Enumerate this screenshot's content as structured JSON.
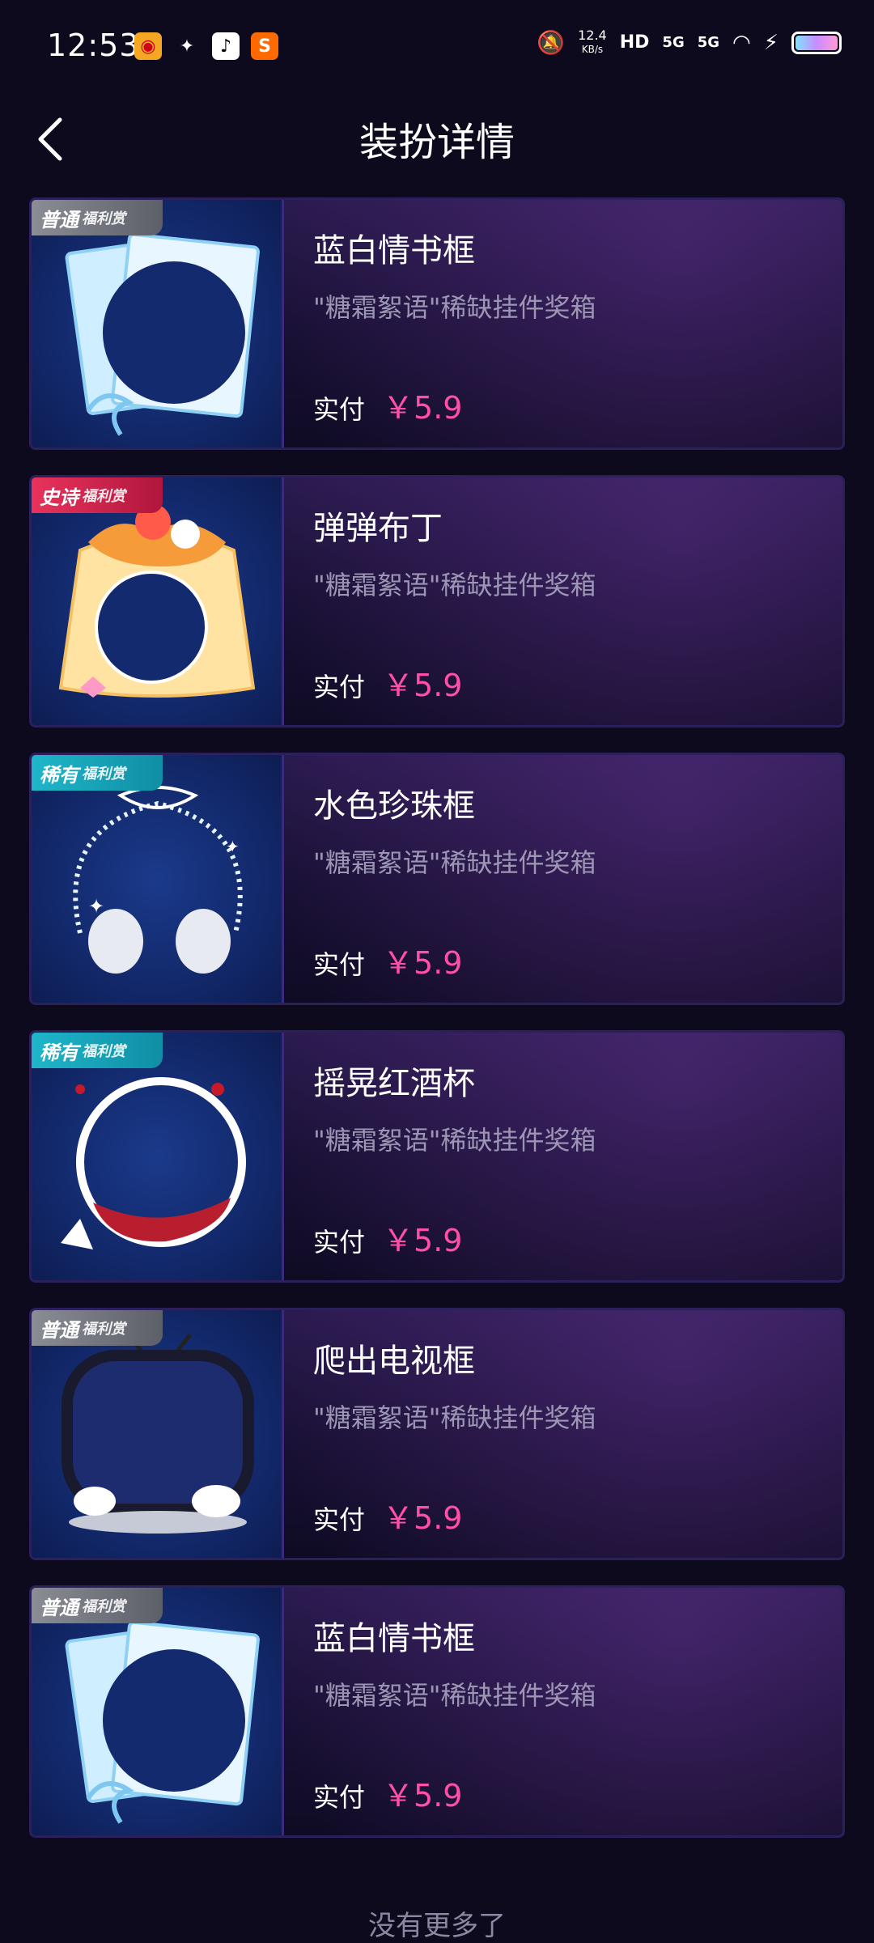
{
  "status_bar": {
    "time": "12:53",
    "net_speed_value": "12.4",
    "net_speed_unit": "KB/s",
    "signal_labels": [
      "HD",
      "5G",
      "5G"
    ]
  },
  "header": {
    "title": "装扮详情"
  },
  "items": [
    {
      "badge": "普通",
      "badge_sub": "福利赏",
      "badge_type": "common",
      "name": "蓝白情书框",
      "source": "\"糖霜絮语\"稀缺挂件奖箱",
      "price_label": "实付",
      "price": "￥5.9"
    },
    {
      "badge": "史诗",
      "badge_sub": "福利赏",
      "badge_type": "epic",
      "name": "弹弹布丁",
      "source": "\"糖霜絮语\"稀缺挂件奖箱",
      "price_label": "实付",
      "price": "￥5.9"
    },
    {
      "badge": "稀有",
      "badge_sub": "福利赏",
      "badge_type": "rare",
      "name": "水色珍珠框",
      "source": "\"糖霜絮语\"稀缺挂件奖箱",
      "price_label": "实付",
      "price": "￥5.9"
    },
    {
      "badge": "稀有",
      "badge_sub": "福利赏",
      "badge_type": "rare",
      "name": "摇晃红酒杯",
      "source": "\"糖霜絮语\"稀缺挂件奖箱",
      "price_label": "实付",
      "price": "￥5.9"
    },
    {
      "badge": "普通",
      "badge_sub": "福利赏",
      "badge_type": "common",
      "name": "爬出电视框",
      "source": "\"糖霜絮语\"稀缺挂件奖箱",
      "price_label": "实付",
      "price": "￥5.9"
    },
    {
      "badge": "普通",
      "badge_sub": "福利赏",
      "badge_type": "common",
      "name": "蓝白情书框",
      "source": "\"糖霜絮语\"稀缺挂件奖箱",
      "price_label": "实付",
      "price": "￥5.9"
    }
  ],
  "footer": {
    "end_text": "没有更多了"
  },
  "colors": {
    "price": "#ff4fa6",
    "background": "#0c0a1c"
  }
}
